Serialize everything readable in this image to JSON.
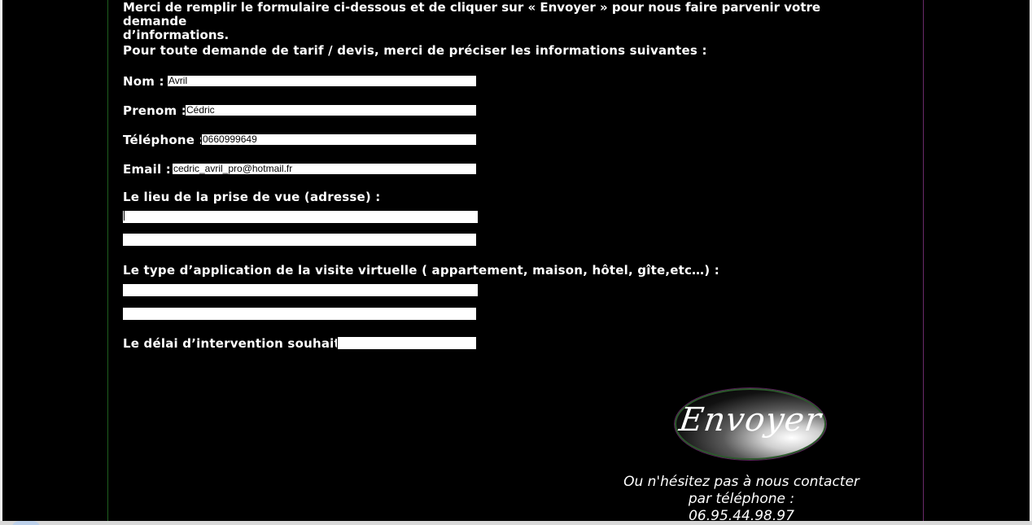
{
  "intro": {
    "line1": "Merci de remplir le formulaire ci-dessous et de cliquer sur « Envoyer » pour nous faire parvenir votre demande",
    "line2": "d’informations.",
    "tarif": "Pour toute demande de tarif / devis, merci de préciser les informations suivantes :"
  },
  "form": {
    "nom_label": "Nom :",
    "nom_value": "Avril",
    "prenom_label": "Prenom :",
    "prenom_value": "Cédric",
    "telephone_label": "Téléphone :",
    "telephone_value": "0660999649",
    "email_label": "Email :",
    "email_value": "cedric_avril_pro@hotmail.fr",
    "lieu_label": "Le lieu de la prise de vue (adresse) :",
    "lieu_line1": "",
    "lieu_line2": "",
    "type_label": "Le type d’application de la visite virtuelle ( appartement, maison, hôtel, gîte,etc…) :",
    "type_line1": "",
    "type_line2": "",
    "delai_label": "Le délai d’intervention souhaité :",
    "delai_value": ""
  },
  "send_button": {
    "label": "Envoyer"
  },
  "contact": {
    "line1": "Ou n'hésitez pas à nous contacter",
    "line2": "par téléphone :",
    "phone": "06.95.44.98.97"
  }
}
